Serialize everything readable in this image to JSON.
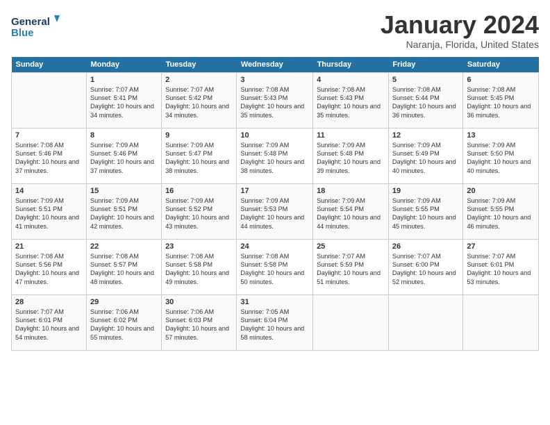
{
  "header": {
    "logo_line1": "General",
    "logo_line2": "Blue",
    "month": "January 2024",
    "location": "Naranja, Florida, United States"
  },
  "days": [
    "Sunday",
    "Monday",
    "Tuesday",
    "Wednesday",
    "Thursday",
    "Friday",
    "Saturday"
  ],
  "weeks": [
    [
      {
        "date": "",
        "sunrise": "",
        "sunset": "",
        "daylight": ""
      },
      {
        "date": "1",
        "sunrise": "Sunrise: 7:07 AM",
        "sunset": "Sunset: 5:41 PM",
        "daylight": "Daylight: 10 hours and 34 minutes."
      },
      {
        "date": "2",
        "sunrise": "Sunrise: 7:07 AM",
        "sunset": "Sunset: 5:42 PM",
        "daylight": "Daylight: 10 hours and 34 minutes."
      },
      {
        "date": "3",
        "sunrise": "Sunrise: 7:08 AM",
        "sunset": "Sunset: 5:43 PM",
        "daylight": "Daylight: 10 hours and 35 minutes."
      },
      {
        "date": "4",
        "sunrise": "Sunrise: 7:08 AM",
        "sunset": "Sunset: 5:43 PM",
        "daylight": "Daylight: 10 hours and 35 minutes."
      },
      {
        "date": "5",
        "sunrise": "Sunrise: 7:08 AM",
        "sunset": "Sunset: 5:44 PM",
        "daylight": "Daylight: 10 hours and 36 minutes."
      },
      {
        "date": "6",
        "sunrise": "Sunrise: 7:08 AM",
        "sunset": "Sunset: 5:45 PM",
        "daylight": "Daylight: 10 hours and 36 minutes."
      }
    ],
    [
      {
        "date": "7",
        "sunrise": "Sunrise: 7:08 AM",
        "sunset": "Sunset: 5:46 PM",
        "daylight": "Daylight: 10 hours and 37 minutes."
      },
      {
        "date": "8",
        "sunrise": "Sunrise: 7:09 AM",
        "sunset": "Sunset: 5:46 PM",
        "daylight": "Daylight: 10 hours and 37 minutes."
      },
      {
        "date": "9",
        "sunrise": "Sunrise: 7:09 AM",
        "sunset": "Sunset: 5:47 PM",
        "daylight": "Daylight: 10 hours and 38 minutes."
      },
      {
        "date": "10",
        "sunrise": "Sunrise: 7:09 AM",
        "sunset": "Sunset: 5:48 PM",
        "daylight": "Daylight: 10 hours and 38 minutes."
      },
      {
        "date": "11",
        "sunrise": "Sunrise: 7:09 AM",
        "sunset": "Sunset: 5:48 PM",
        "daylight": "Daylight: 10 hours and 39 minutes."
      },
      {
        "date": "12",
        "sunrise": "Sunrise: 7:09 AM",
        "sunset": "Sunset: 5:49 PM",
        "daylight": "Daylight: 10 hours and 40 minutes."
      },
      {
        "date": "13",
        "sunrise": "Sunrise: 7:09 AM",
        "sunset": "Sunset: 5:50 PM",
        "daylight": "Daylight: 10 hours and 40 minutes."
      }
    ],
    [
      {
        "date": "14",
        "sunrise": "Sunrise: 7:09 AM",
        "sunset": "Sunset: 5:51 PM",
        "daylight": "Daylight: 10 hours and 41 minutes."
      },
      {
        "date": "15",
        "sunrise": "Sunrise: 7:09 AM",
        "sunset": "Sunset: 5:51 PM",
        "daylight": "Daylight: 10 hours and 42 minutes."
      },
      {
        "date": "16",
        "sunrise": "Sunrise: 7:09 AM",
        "sunset": "Sunset: 5:52 PM",
        "daylight": "Daylight: 10 hours and 43 minutes."
      },
      {
        "date": "17",
        "sunrise": "Sunrise: 7:09 AM",
        "sunset": "Sunset: 5:53 PM",
        "daylight": "Daylight: 10 hours and 44 minutes."
      },
      {
        "date": "18",
        "sunrise": "Sunrise: 7:09 AM",
        "sunset": "Sunset: 5:54 PM",
        "daylight": "Daylight: 10 hours and 44 minutes."
      },
      {
        "date": "19",
        "sunrise": "Sunrise: 7:09 AM",
        "sunset": "Sunset: 5:55 PM",
        "daylight": "Daylight: 10 hours and 45 minutes."
      },
      {
        "date": "20",
        "sunrise": "Sunrise: 7:09 AM",
        "sunset": "Sunset: 5:55 PM",
        "daylight": "Daylight: 10 hours and 46 minutes."
      }
    ],
    [
      {
        "date": "21",
        "sunrise": "Sunrise: 7:08 AM",
        "sunset": "Sunset: 5:56 PM",
        "daylight": "Daylight: 10 hours and 47 minutes."
      },
      {
        "date": "22",
        "sunrise": "Sunrise: 7:08 AM",
        "sunset": "Sunset: 5:57 PM",
        "daylight": "Daylight: 10 hours and 48 minutes."
      },
      {
        "date": "23",
        "sunrise": "Sunrise: 7:08 AM",
        "sunset": "Sunset: 5:58 PM",
        "daylight": "Daylight: 10 hours and 49 minutes."
      },
      {
        "date": "24",
        "sunrise": "Sunrise: 7:08 AM",
        "sunset": "Sunset: 5:58 PM",
        "daylight": "Daylight: 10 hours and 50 minutes."
      },
      {
        "date": "25",
        "sunrise": "Sunrise: 7:07 AM",
        "sunset": "Sunset: 5:59 PM",
        "daylight": "Daylight: 10 hours and 51 minutes."
      },
      {
        "date": "26",
        "sunrise": "Sunrise: 7:07 AM",
        "sunset": "Sunset: 6:00 PM",
        "daylight": "Daylight: 10 hours and 52 minutes."
      },
      {
        "date": "27",
        "sunrise": "Sunrise: 7:07 AM",
        "sunset": "Sunset: 6:01 PM",
        "daylight": "Daylight: 10 hours and 53 minutes."
      }
    ],
    [
      {
        "date": "28",
        "sunrise": "Sunrise: 7:07 AM",
        "sunset": "Sunset: 6:01 PM",
        "daylight": "Daylight: 10 hours and 54 minutes."
      },
      {
        "date": "29",
        "sunrise": "Sunrise: 7:06 AM",
        "sunset": "Sunset: 6:02 PM",
        "daylight": "Daylight: 10 hours and 55 minutes."
      },
      {
        "date": "30",
        "sunrise": "Sunrise: 7:06 AM",
        "sunset": "Sunset: 6:03 PM",
        "daylight": "Daylight: 10 hours and 57 minutes."
      },
      {
        "date": "31",
        "sunrise": "Sunrise: 7:05 AM",
        "sunset": "Sunset: 6:04 PM",
        "daylight": "Daylight: 10 hours and 58 minutes."
      },
      {
        "date": "",
        "sunrise": "",
        "sunset": "",
        "daylight": ""
      },
      {
        "date": "",
        "sunrise": "",
        "sunset": "",
        "daylight": ""
      },
      {
        "date": "",
        "sunrise": "",
        "sunset": "",
        "daylight": ""
      }
    ]
  ]
}
